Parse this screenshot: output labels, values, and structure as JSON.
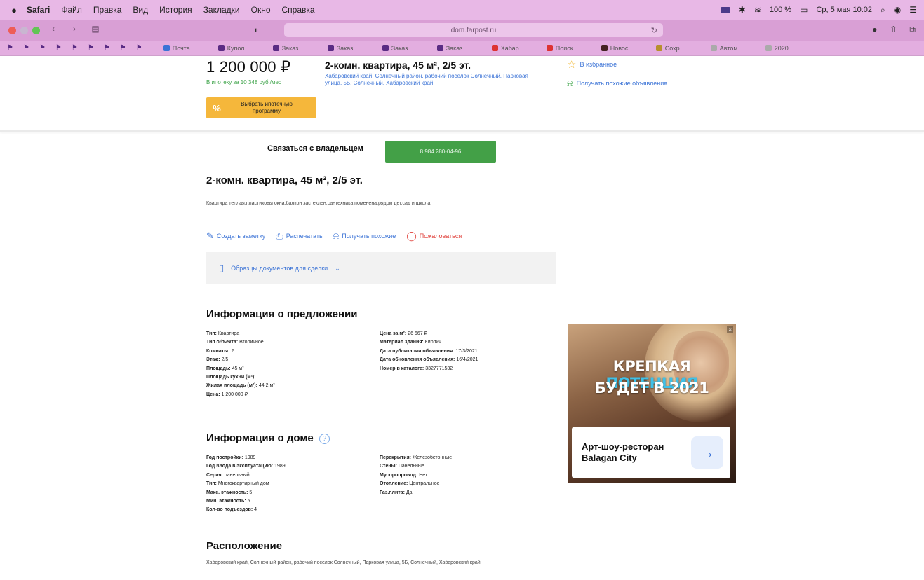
{
  "menubar": {
    "app": "Safari",
    "items": [
      "Файл",
      "Правка",
      "Вид",
      "История",
      "Закладки",
      "Окно",
      "Справка"
    ],
    "battery": "100 %",
    "datetime": "Ср, 5 мая 10:02"
  },
  "browser": {
    "url": "dom.farpost.ru",
    "bookmarks": [
      "Почта...",
      "Купол...",
      "Заказ...",
      "Заказ...",
      "Заказ...",
      "Заказ...",
      "Хабар...",
      "Поиск...",
      "Новос...",
      "Сохр...",
      "Автом...",
      "2020..."
    ]
  },
  "header": {
    "price": "1 200 000 ₽",
    "mortgage_note": "В ипотеку за 10 348 руб./мес",
    "mortgage_button": "Выбрать ипотечную программу",
    "title": "2-комн. квартира, 45 м², 2/5 эт.",
    "address": "Хабаровский край, Солнечный район, рабочий поселок Солнечный, Парковая улица, 5Б, Солнечный, Хабаровский край",
    "favorite": "В избранное",
    "similar": "Получать похожие объявления"
  },
  "contact": {
    "label": "Связаться с владельцем",
    "phone": "8 984 280-04-96"
  },
  "listing": {
    "title": "2-комн. квартира, 45 м², 2/5 эт.",
    "description": "Квартира теплая,пластиковы окна,балкон застеклен,сантехника поменена,рядом дет.сад и школа.",
    "actions": {
      "note": "Создать заметку",
      "print": "Распечатать",
      "similar": "Получать похожие",
      "complain": "Пожаловаться"
    },
    "docs": "Образцы документов для сделки"
  },
  "offer_info": {
    "title": "Информация о предложении",
    "left": [
      {
        "k": "Тип:",
        "v": "Квартира"
      },
      {
        "k": "Тип объекта:",
        "v": "Вторичное"
      },
      {
        "k": "Комнаты:",
        "v": "2"
      },
      {
        "k": "Этаж:",
        "v": "2/5"
      },
      {
        "k": "Площадь:",
        "v": "45 м²"
      },
      {
        "k": "Площадь кухни (м²):",
        "v": ""
      },
      {
        "k": "Жилая площадь (м²):",
        "v": "44.2 м²"
      },
      {
        "k": "Цена:",
        "v": "1 200 000 ₽"
      }
    ],
    "right": [
      {
        "k": "Цена за м²:",
        "v": "26 667 ₽"
      },
      {
        "k": "Материал здания:",
        "v": "Кирпич"
      },
      {
        "k": "Дата публикации объявления:",
        "v": "17/3/2021"
      },
      {
        "k": "Дата обновления объявления:",
        "v": "16/4/2021"
      },
      {
        "k": "Номер в каталоге:",
        "v": "3327771532"
      }
    ]
  },
  "house_info": {
    "title": "Информация о доме",
    "left": [
      {
        "k": "Год постройки:",
        "v": "1989"
      },
      {
        "k": "Год ввода в эксплуатацию:",
        "v": "1989"
      },
      {
        "k": "Серия:",
        "v": "панельный"
      },
      {
        "k": "Тип:",
        "v": "Многоквартирный дом"
      },
      {
        "k": "Макс. этажность:",
        "v": "5"
      },
      {
        "k": "Мин. этажность:",
        "v": "5"
      },
      {
        "k": "Кол-во подъездов:",
        "v": "4"
      }
    ],
    "right": [
      {
        "k": "Перекрытия:",
        "v": "Железобетонные"
      },
      {
        "k": "Стены:",
        "v": "Панельные"
      },
      {
        "k": "Мусоропровод:",
        "v": "Нет"
      },
      {
        "k": "Отопление:",
        "v": "Центральное"
      },
      {
        "k": "Газ.плита:",
        "v": "Да"
      }
    ]
  },
  "location": {
    "title": "Расположение",
    "text": "Хабаровский край, Солнечный район, рабочий поселок Солнечный, Парковая улица, 5Б, Солнечный, Хабаровский край"
  },
  "ad": {
    "headline_part1": "КРЕПКАЯ ",
    "headline_accent": "ПОТЕНЦИЯ",
    "headline_line2": "БУДЕТ В 2021",
    "card_text": "Арт-шоу-ресторан Balagan City",
    "accent_color": "#3fc1e8"
  }
}
